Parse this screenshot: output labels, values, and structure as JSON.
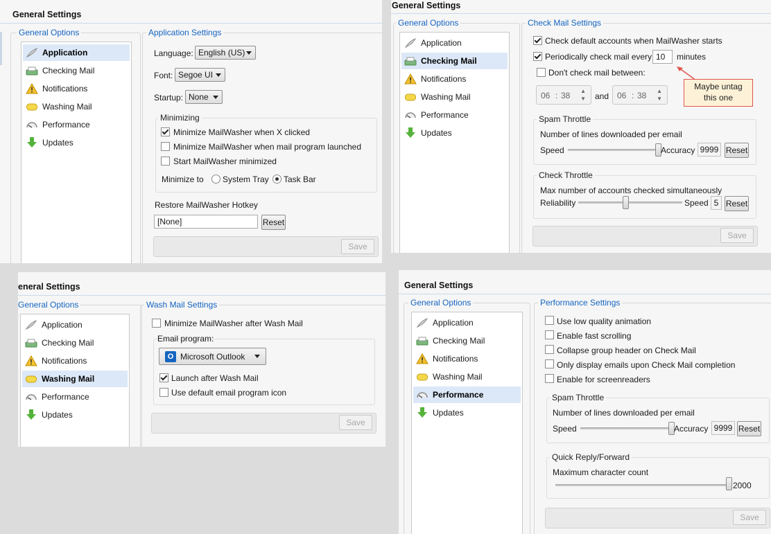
{
  "nav_items": [
    "Application",
    "Checking Mail",
    "Notifications",
    "Washing Mail",
    "Performance",
    "Updates"
  ],
  "icons": [
    "feather-icon",
    "mail-tray-icon",
    "warning-icon",
    "soap-icon",
    "speedometer-icon",
    "download-arrow-icon"
  ],
  "colors": {
    "accent": "#1565c0",
    "selected_bg": "#dce8f7",
    "note_border": "#e0564f",
    "note_bg": "#fdf2d8"
  },
  "common": {
    "window_title": "General Settings",
    "window_title_cropped": "eneral Settings",
    "general_options": "General Options",
    "save": "Save",
    "reset": "Reset"
  },
  "application": {
    "section_title": "Application Settings",
    "language_label": "Language:",
    "language_value": "English (US)",
    "font_label": "Font:",
    "font_value": "Segoe UI",
    "startup_label": "Startup:",
    "startup_value": "None",
    "minimizing_title": "Minimizing",
    "minimize_on_close": "Minimize MailWasher when X clicked",
    "minimize_on_close_checked": true,
    "minimize_on_launch": "Minimize MailWasher when mail program launched",
    "minimize_on_launch_checked": false,
    "start_minimized": "Start MailWasher minimized",
    "start_minimized_checked": false,
    "minimize_to_label": "Minimize to",
    "system_tray": "System Tray",
    "task_bar": "Task Bar",
    "minimize_to_value": "Task Bar",
    "hotkey_label": "Restore MailWasher Hotkey",
    "hotkey_value": "[None]"
  },
  "checking": {
    "section_title": "Check Mail Settings",
    "check_default": "Check default accounts when MailWasher starts",
    "check_default_checked": true,
    "periodically": "Periodically check mail every",
    "periodically_checked": true,
    "interval": "10",
    "minutes": "minutes",
    "dont_check": "Don't check mail between:",
    "dont_check_checked": false,
    "time_from_h": "06",
    "time_from_m": "38",
    "time_and": "and",
    "time_to_h": "06",
    "time_to_m": "38",
    "annotation": "Maybe untag this one",
    "spam_throttle_title": "Spam Throttle",
    "spam_desc": "Number of lines downloaded per email",
    "speed": "Speed",
    "accuracy": "Accuracy",
    "spam_value": "9999",
    "spam_level": 0.98,
    "check_throttle_title": "Check Throttle",
    "check_desc": "Max number of accounts checked simultaneously",
    "reliability": "Reliability",
    "check_value": "5",
    "check_level": 0.45
  },
  "washing": {
    "section_title": "Wash Mail Settings",
    "minimize_after": "Minimize MailWasher after Wash Mail",
    "minimize_after_checked": false,
    "email_program_label": "Email program:",
    "email_program_value": "Microsoft Outlook",
    "launch_after": "Launch after Wash Mail",
    "launch_after_checked": true,
    "use_default_icon": "Use default email program icon",
    "use_default_icon_checked": false
  },
  "performance": {
    "section_title": "Performance Settings",
    "low_quality": "Use low quality animation",
    "fast_scrolling": "Enable fast scrolling",
    "collapse_header": "Collapse group header on Check Mail",
    "only_display": "Only display emails upon Check Mail completion",
    "screenreaders": "Enable for screenreaders",
    "spam_throttle_title": "Spam Throttle",
    "spam_desc": "Number of lines downloaded per email",
    "speed": "Speed",
    "accuracy": "Accuracy",
    "spam_value": "9999",
    "spam_level": 0.98,
    "quick_reply_title": "Quick Reply/Forward",
    "max_chars": "Maximum character count",
    "max_chars_value": "2000",
    "max_chars_level": 1.0
  }
}
